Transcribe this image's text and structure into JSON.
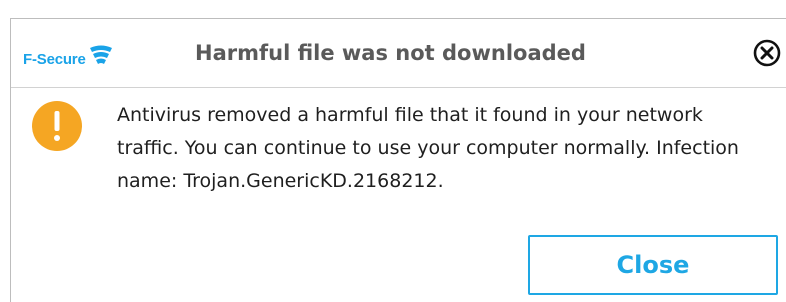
{
  "brand": {
    "logo_text": "F-Secure",
    "logo_icon": "f-secure-wave-logo",
    "color": "#1aa3e8"
  },
  "dialog": {
    "title": "Harmful file was not downloaded",
    "close_icon": "circled-x-icon",
    "warning_icon": "exclamation-circle-icon",
    "warning_color": "#f5a623",
    "message": "Antivirus removed a harmful file that it found in your network traffic. You can continue to use your computer normally. Infection name: Trojan.GenericKD.2168212.",
    "close_button_label": "Close",
    "accent_color": "#1ea7e4"
  }
}
